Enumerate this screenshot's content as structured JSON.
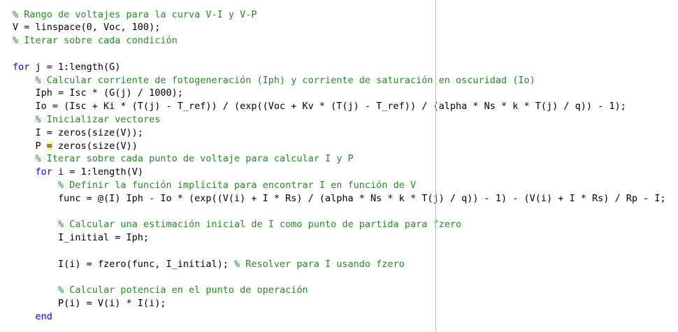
{
  "editor": {
    "colors": {
      "background": "#ffffff",
      "comment": "#228B22",
      "keyword": "#0E00FF",
      "code": "#000000",
      "margin_line": "#b8b8b8",
      "cursor_highlight": "#ffd700"
    },
    "lines": [
      {
        "segments": [
          {
            "type": "comment",
            "text": "% Rango de voltajes para la curva V-I y V-P"
          }
        ]
      },
      {
        "segments": [
          {
            "type": "code",
            "text": "V = linspace(0, Voc, 100);"
          }
        ]
      },
      {
        "segments": [
          {
            "type": "comment",
            "text": "% Iterar sobre cada condición"
          }
        ]
      },
      {
        "segments": []
      },
      {
        "segments": [
          {
            "type": "keyword",
            "text": "for"
          },
          {
            "type": "code",
            "text": " j = 1:length(G)"
          }
        ]
      },
      {
        "segments": [
          {
            "type": "code",
            "text": "    "
          },
          {
            "type": "comment",
            "text": "% Calcular corriente de fotogeneración (Iph) y corriente de saturación en oscuridad (Io)"
          }
        ]
      },
      {
        "segments": [
          {
            "type": "code",
            "text": "    Iph = Isc * (G(j) / 1000);"
          }
        ]
      },
      {
        "segments": [
          {
            "type": "code",
            "text": "    Io = (Isc + Ki * (T(j) - T_ref)) / (exp((Voc + Kv * (T(j) - T_ref)) / (alpha * Ns * k * T(j) / q)) - 1);"
          }
        ]
      },
      {
        "segments": [
          {
            "type": "code",
            "text": "    "
          },
          {
            "type": "comment",
            "text": "% Inicializar vectores"
          }
        ]
      },
      {
        "segments": [
          {
            "type": "code",
            "text": "    I = zeros(size(V));"
          }
        ]
      },
      {
        "segments": [
          {
            "type": "code",
            "text": "    P "
          },
          {
            "type": "cursor",
            "text": "="
          },
          {
            "type": "code",
            "text": " zeros(size(V))"
          }
        ]
      },
      {
        "segments": [
          {
            "type": "code",
            "text": "    "
          },
          {
            "type": "comment",
            "text": "% Iterar sobre cada punto de voltaje para calcular I y P"
          }
        ]
      },
      {
        "segments": [
          {
            "type": "code",
            "text": "    "
          },
          {
            "type": "keyword",
            "text": "for"
          },
          {
            "type": "code",
            "text": " i = 1:length(V)"
          }
        ]
      },
      {
        "segments": [
          {
            "type": "code",
            "text": "        "
          },
          {
            "type": "comment",
            "text": "% Definir la función implícita para encontrar I en función de V"
          }
        ]
      },
      {
        "segments": [
          {
            "type": "code",
            "text": "        func = @(I) Iph - Io * (exp((V(i) + I * Rs) / (alpha * Ns * k * T(j) / q)) - 1) - (V(i) + I * Rs) / Rp - I;"
          }
        ]
      },
      {
        "segments": []
      },
      {
        "segments": [
          {
            "type": "code",
            "text": "        "
          },
          {
            "type": "comment",
            "text": "% Calcular una estimación inicial de I como punto de partida para fzero"
          }
        ]
      },
      {
        "segments": [
          {
            "type": "code",
            "text": "        I_initial = Iph;"
          }
        ]
      },
      {
        "segments": []
      },
      {
        "segments": [
          {
            "type": "code",
            "text": "        I(i) = fzero(func, I_initial); "
          },
          {
            "type": "comment",
            "text": "% Resolver para I usando fzero"
          }
        ]
      },
      {
        "segments": []
      },
      {
        "segments": [
          {
            "type": "code",
            "text": "        "
          },
          {
            "type": "comment",
            "text": "% Calcular potencia en el punto de operación"
          }
        ]
      },
      {
        "segments": [
          {
            "type": "code",
            "text": "        P(i) = V(i) * I(i);"
          }
        ]
      },
      {
        "segments": [
          {
            "type": "code",
            "text": "    "
          },
          {
            "type": "keyword",
            "text": "end"
          }
        ]
      }
    ]
  }
}
